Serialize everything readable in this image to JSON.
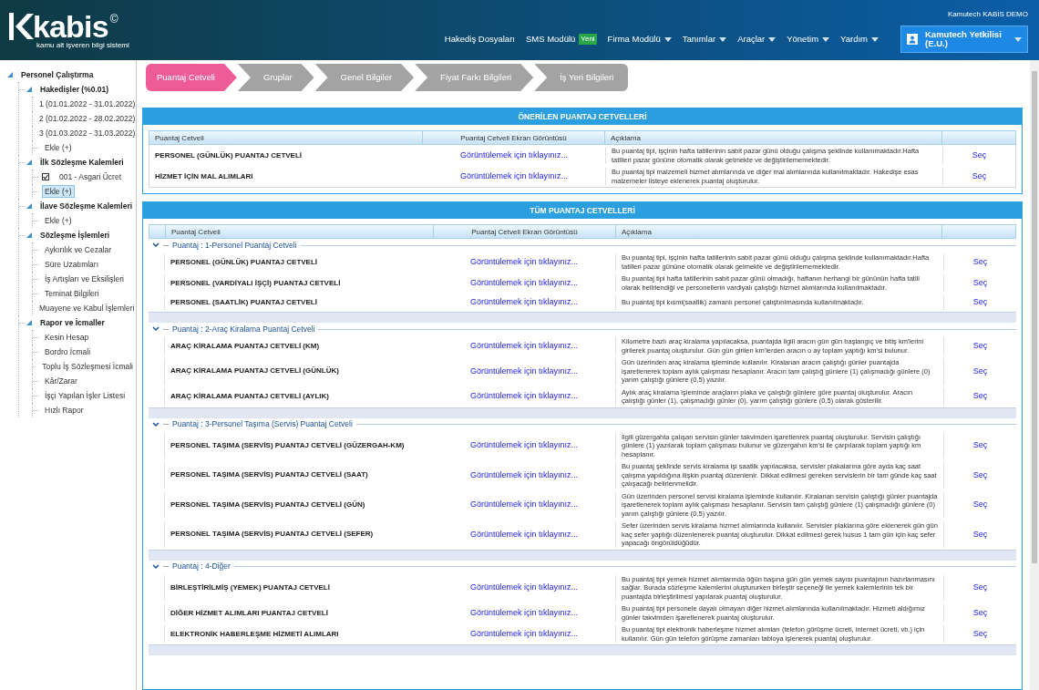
{
  "header": {
    "logo": {
      "name": "kabis",
      "mark": "©",
      "tagline": "kamu alt işveren bilgi sistemi"
    },
    "company": "Kamutech KABİS DEMO",
    "nav": [
      {
        "label": "Hakediş Dosyaları",
        "dropdown": false
      },
      {
        "label": "SMS Modülü",
        "badge": "Yeni",
        "dropdown": false
      },
      {
        "label": "Firma Modülü",
        "dropdown": true
      },
      {
        "label": "Tanımlar",
        "dropdown": true
      },
      {
        "label": "Araçlar",
        "dropdown": true
      },
      {
        "label": "Yönetim",
        "dropdown": true
      },
      {
        "label": "Yardım",
        "dropdown": true
      }
    ],
    "user": {
      "name": "Kamutech Yetkilisi (E.U.)"
    }
  },
  "sidebar": {
    "tree": [
      {
        "label": "Personel Çalıştırma",
        "selected": false,
        "children": [
          {
            "label": "Hakedişler (%0.01)",
            "selected": false,
            "children": [
              {
                "label": "1 (01.01.2022 - 31.01.2022)",
                "selected": false
              },
              {
                "label": "2 (01.02.2022 - 28.02.2022)",
                "selected": false
              },
              {
                "label": "3 (01.03.2022 - 31.03.2022)",
                "selected": false
              },
              {
                "label": "Ekle (+)",
                "selected": false
              }
            ]
          },
          {
            "label": "İlk Sözleşme Kalemleri",
            "selected": false,
            "children": [
              {
                "label": "001 - Asgari Ücret",
                "selected": false,
                "checked": true
              },
              {
                "label": "Ekle (+)",
                "selected": true
              }
            ]
          },
          {
            "label": "İlave Sözleşme Kalemleri",
            "selected": false,
            "children": [
              {
                "label": "Ekle (+)",
                "selected": false
              }
            ]
          },
          {
            "label": "Sözleşme İşlemleri",
            "selected": false,
            "children": [
              {
                "label": "Aykırılık ve Cezalar",
                "selected": false
              },
              {
                "label": "Süre Uzatımları",
                "selected": false
              },
              {
                "label": "İş Artışları ve Eksilişleri",
                "selected": false
              },
              {
                "label": "Teminat Bilgileri",
                "selected": false
              },
              {
                "label": "Muayene ve Kabul İşlemleri",
                "selected": false
              }
            ]
          },
          {
            "label": "Rapor ve İcmaller",
            "selected": false,
            "children": [
              {
                "label": "Kesin Hesap",
                "selected": false
              },
              {
                "label": "Bordro İcmali",
                "selected": false
              },
              {
                "label": "Toplu İş Sözleşmesi İcmali",
                "selected": false
              },
              {
                "label": "Kâr/Zarar",
                "selected": false
              },
              {
                "label": "İşçi Yapılan İşler Listesi",
                "selected": false
              },
              {
                "label": "Hızlı Rapor",
                "selected": false
              }
            ]
          }
        ]
      }
    ]
  },
  "wizard": [
    {
      "label": "Puantaj Cetveli",
      "selected": true
    },
    {
      "label": "Gruplar",
      "selected": false
    },
    {
      "label": "Genel Bilgiler",
      "selected": false
    },
    {
      "label": "Fiyat Farkı Bilgileri",
      "selected": false
    },
    {
      "label": "İş Yeri Bilgileri",
      "selected": false
    }
  ],
  "suggested": {
    "title": "ÖNERİLEN PUANTAJ CETVELLERİ",
    "columns": [
      "Puantaj Cetveli",
      "Puantaj Cetveli Ekran Görüntüsü",
      "Açıklama"
    ],
    "rows": [
      {
        "name": "PERSONEL (GÜNLÜK) PUANTAJ CETVELİ",
        "link": "Görüntülemek için tıklayınız...",
        "description": "Bu puantaj tipi, işçinin hafta tatillerinin sabit pazar günü olduğu çalışma şeklinde kullanımaktadır.Hafta tatilleri pazar gününe otomatik olarak gelmekte ve değiştirilememektedir.",
        "action": "Seç"
      },
      {
        "name": "HİZMET İÇİN MAL ALIMLARI",
        "link": "Görüntülemek için tıklayınız...",
        "description": "Bu puantaj tipi malzemeli hizmet alımlarında ve diğer mal alımlarında kullanılmaktadır. Hakedişe esas malzemeler listeye eklenerek puantaj oluşturulur.",
        "action": "Seç"
      }
    ]
  },
  "all": {
    "title": "TÜM PUANTAJ CETVELLERİ",
    "columns": [
      "Puantaj Cetveli",
      "Puantaj Cetveli Ekran Görüntüsü",
      "Açıklama"
    ],
    "groups": [
      {
        "title": "Puantaj : 1-Personel Puantaj Cetveli",
        "expanded": true,
        "rows": [
          {
            "name": "PERSONEL (GÜNLÜK) PUANTAJ CETVELİ",
            "link": "Görüntülemek için tıklayınız...",
            "description": "Bu puantaj tipi, işçinin hafta tatillerinin sabit pazar günü olduğu çalışma şeklinde kullanımaktadır.Hafta tatilleri pazar gününe otomatik olarak gelmekte ve değiştirilememektedir.",
            "action": "Seç"
          },
          {
            "name": "PERSONEL (VARDİYALI İŞÇİ) PUANTAJ CETVELİ",
            "link": "Görüntülemek için tıklayınız...",
            "description": "Bu puantaj tipi hafta tatillerinin sabit pazar günü olmadığı, haftanın herhangi bir gününün hafta tatili olarak belirlendiği ve personellerin vardiyalı çalıştığı hizmet alımlarında kullanılmaktadır.",
            "action": "Seç"
          },
          {
            "name": "PERSONEL (SAATLİK) PUANTAJ CETVELİ",
            "link": "Görüntülemek için tıklayınız...",
            "description": "Bu puantaj tipi kısmi(saatlik) zamanlı personel çalıştırılmasında kullanılmaktadır.",
            "action": "Seç"
          }
        ]
      },
      {
        "title": "Puantaj : 2-Araç Kiralama Puantaj Cetveli",
        "expanded": true,
        "rows": [
          {
            "name": "ARAÇ KİRALAMA PUANTAJ CETVELİ (KM)",
            "link": "Görüntülemek için tıklayınız...",
            "description": "Kilometre bazlı araç kiralama yapılacaksa, puantajda ilgili aracın gün gün başlangıç ve bitiş km'lerini girilerek puantaj oluşturulur. Gün gün girilen km'lerden aracın o ay toplam yaptığı km'si bulunur.",
            "action": "Seç"
          },
          {
            "name": "ARAÇ KİRALAMA PUANTAJ CETVELİ (GÜNLÜK)",
            "link": "Görüntülemek için tıklayınız...",
            "description": "Gün üzerinden araç kiralama işleminde kullanılır. Kiralanan aracın çalıştığı günler puantajda işaretlenerek toplam aylık çalışması hesaplanır. Aracın tam çalıştığ günlere (1) çalışmadığı günlere (0) yarım çalıştığı günlere (0,5) yazılır.",
            "action": "Seç"
          },
          {
            "name": "ARAÇ KİRALAMA PUANTAJ CETVELİ (AYLIK)",
            "link": "Görüntülemek için tıklayınız...",
            "description": "Aylık araç kiralama işleminde araçların plaka ve çalıştığı günlere göre puantaj oluşturulur. Aracın çalıştığı günler (1), çalışmadığı günler (0), yarım çalıştığı günlere (0,5) olarak gösterilir.",
            "action": "Seç"
          }
        ]
      },
      {
        "title": "Puantaj : 3-Personel Taşıma (Servis) Puantaj Cetveli",
        "expanded": true,
        "rows": [
          {
            "name": "PERSONEL TAŞIMA (SERVİS) PUANTAJ CETVELİ (GÜZERGAH-KM)",
            "link": "Görüntülemek için tıklayınız...",
            "description": "İlgili güzergahta çalışan servisin günler takvimden işaretlenrek puantaj oluşturulur. Servisin çalıştığı günlere (1) yazılarak toplam çalışması bulunur ve güzergahın km'si ile çarpılarak toplam yaptığı km hesaplanır.",
            "action": "Seç"
          },
          {
            "name": "PERSONEL TAŞIMA (SERVİS) PUANTAJ CETVELİ (SAAT)",
            "link": "Görüntülemek için tıklayınız...",
            "description": "Bu puantaj şeklinde servis kiralama işi saatlik yapılacaksa, servisler plakalarına göre ayda kaç saat çalışma yapıldığına ilişkin puantaj düzenlenir. Dikkat edilmesi gereken servislerin bir tam günde kaç saat çalışacağı belirlenmelidir.",
            "action": "Seç"
          },
          {
            "name": "PERSONEL TAŞIMA (SERVİS) PUANTAJ CETVELİ (GÜN)",
            "link": "Görüntülemek için tıklayınız...",
            "description": "Gün üzerinden personel servisi kiralama işleminde kullanılır. Kiralanan servisin çalıştığı günler puantajda işaretlenerek toplam aylık çalışması hesaplanır. Servisin tam çalıştığ günlere (1) çalışmadığı günlere (0) yarım çalıştığı günlere (0,5) yazılır.",
            "action": "Seç"
          },
          {
            "name": "PERSONEL TAŞIMA (SERVİS) PUANTAJ CETVELİ (SEFER)",
            "link": "Görüntülemek için tıklayınız...",
            "description": "Sefer üzerinden servis kiralama hizmet alımlarında kullanılır. Servisler plaklarına göre eklenerek gün gün kaç sefer yaptığı düzenlenerek puantaj oluşturulur. Dikkat edilmesi gerek husus 1 tam gün için kaç sefer yapacağı öngörüldüğüdür.",
            "action": "Seç"
          }
        ]
      },
      {
        "title": "Puantaj : 4-Diğer",
        "expanded": true,
        "rows": [
          {
            "name": "BİRLEŞTİRİLMİŞ (YEMEK) PUANTAJ CETVELİ",
            "link": "Görüntülemek için tıklayınız...",
            "description": "Bu puantaj tipi yemek hizmet alımlarında öğün başına gün gün yemek sayısı puantajının hazırlanmasını sağlar. Burada sözleşme kalemlerini oluştururken birleştir seçeneği ile yemek kalemlerinin tek bir puantajda birleştirilmesi yapılarak puantaj oluşturulur.",
            "action": "Seç"
          },
          {
            "name": "DİĞER HİZMET ALIMLARI PUANTAJ CETVELİ",
            "link": "Görüntülemek için tıklayınız...",
            "description": "Bu puantaj tipi personele dayalı olmayan diğer hizmet alımlarında kullanılmaktadır. Hizmeti aldığımız günler takvimden işaretlenerek puantaj oluşturulur.",
            "action": "Seç"
          },
          {
            "name": "ELEKTRONİK HABERLEŞME HİZMETİ ALIMLARI",
            "link": "Görüntülemek için tıklayınız...",
            "description": "Bu puantaj tipi elektronik haberleşme hizmet alımları (telefon görüşme ücreti, internet ücreti, vb.) için kullanılır. Gün gün telefon görüşme zamanları tabloya işlenerek puantaj oluşturulur.",
            "action": "Seç"
          }
        ]
      }
    ]
  }
}
